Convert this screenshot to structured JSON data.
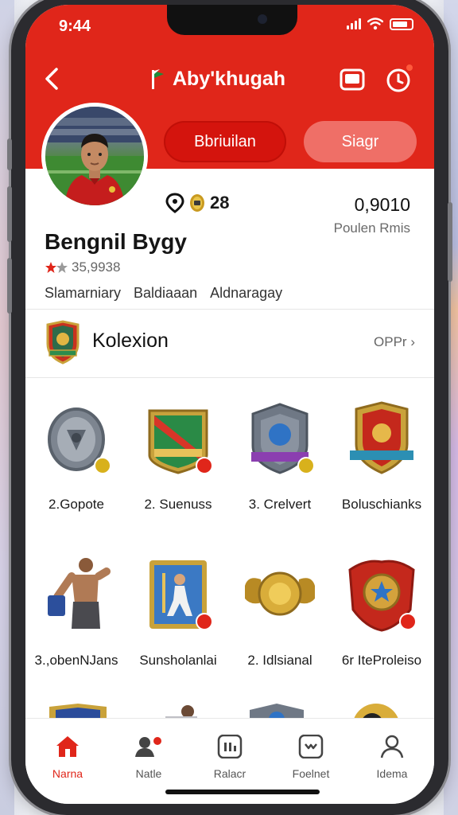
{
  "status": {
    "time": "9:44"
  },
  "header": {
    "title": "Aby'khugah"
  },
  "actions": {
    "primary": "Bbriuilan",
    "secondary": "Siagr"
  },
  "profile": {
    "stats_count": "28",
    "stats_value": "0,9010",
    "stats_value_label": "Poulen Rmis",
    "name": "Bengnil Bygy",
    "rating": "35,9938",
    "tags": [
      "Slamarniary",
      "Baldiaaan",
      "Aldnaragay"
    ]
  },
  "collection": {
    "title": "Kolexion",
    "more": "OPPr",
    "items": [
      {
        "label": "2.Gopote",
        "icon": "silver-shield-icon"
      },
      {
        "label": "2. Suenuss",
        "icon": "green-flag-shield-icon"
      },
      {
        "label": "3. Crelvert",
        "icon": "blue-crest-icon"
      },
      {
        "label": "Boluschianks",
        "icon": "red-crest-icon"
      },
      {
        "label": "3.,obenNJans",
        "icon": "athlete-figure-icon"
      },
      {
        "label": "Sunsholanlai",
        "icon": "player-card-icon"
      },
      {
        "label": "2. Idlsianal",
        "icon": "gold-helmet-icon"
      },
      {
        "label": "6r IteProleiso",
        "icon": "winged-shield-icon"
      }
    ]
  },
  "nav": {
    "items": [
      {
        "label": "Narna",
        "icon": "home-icon",
        "active": true
      },
      {
        "label": "Natle",
        "icon": "friends-icon",
        "active": false
      },
      {
        "label": "Ralacr",
        "icon": "grid-icon",
        "active": false
      },
      {
        "label": "Foelnet",
        "icon": "chat-icon",
        "active": false
      },
      {
        "label": "Idema",
        "icon": "profile-icon",
        "active": false
      }
    ]
  },
  "colors": {
    "primary_red": "#e0261a",
    "secondary_red": "#ef6f67"
  }
}
